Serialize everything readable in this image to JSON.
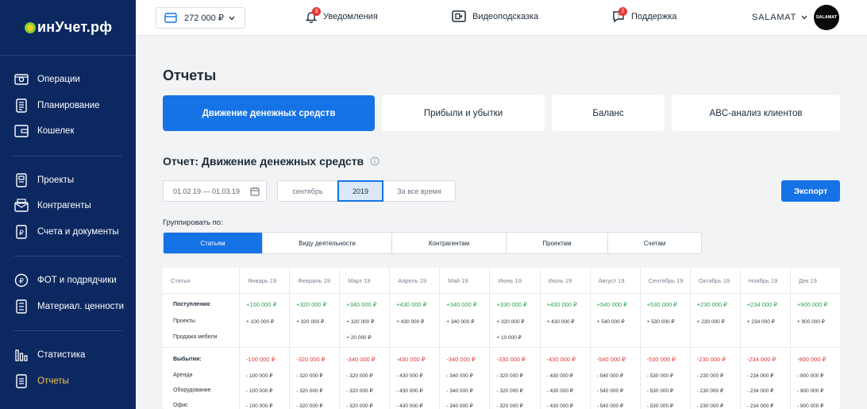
{
  "logo": {
    "text": "инУчет.рф"
  },
  "sidebar": {
    "groups": [
      [
        {
          "label": "Операции",
          "icon": "wallet-card-icon"
        },
        {
          "label": "Планирование",
          "icon": "planning-icon"
        },
        {
          "label": "Кошелек",
          "icon": "wallet-icon"
        }
      ],
      [
        {
          "label": "Проекты",
          "icon": "projects-icon"
        },
        {
          "label": "Контрагенты",
          "icon": "contacts-icon"
        },
        {
          "label": "Счета и документы",
          "icon": "documents-icon"
        }
      ],
      [
        {
          "label": "ФОТ и подрядчики",
          "icon": "payroll-icon"
        },
        {
          "label": "Материал. ценности",
          "icon": "inventory-icon"
        }
      ],
      [
        {
          "label": "Статистика",
          "icon": "statistics-icon"
        },
        {
          "label": "Отчеты",
          "icon": "reports-icon",
          "active": true
        }
      ]
    ]
  },
  "header": {
    "balance": "272 000 ₽",
    "notifications": {
      "label": "Уведомления",
      "count": "3"
    },
    "video_hint": {
      "label": "Видеоподсказка"
    },
    "support": {
      "label": "Поддержка",
      "count": "2"
    },
    "user": "SALAMAT",
    "avatar_text": "SALAMAT"
  },
  "page": {
    "title": "Отчеты",
    "report_tabs": [
      "Движение денежных средств",
      "Прибыли и убытки",
      "Баланс",
      "ABC-анализ клиентов"
    ],
    "section_title": "Отчет: Движение денежных средств",
    "date_range": "01.02 19 — 01.03.19",
    "periods": [
      "сентябрь",
      "2019",
      "За все время"
    ],
    "export_label": "Экспорт",
    "group_by_label": "Группировать по:",
    "group_tabs": [
      "Статьям",
      "Виду деятельности",
      "Контрагентам",
      "Проектам",
      "Счетам"
    ]
  },
  "table": {
    "first_header": "Статья",
    "months": [
      "Январь 19",
      "Февраль 19",
      "Март 19",
      "Апрель 19",
      "Май 19",
      "Июнь 19",
      "Июль 19",
      "Август 19",
      "Сентябрь 19",
      "Октябрь 19",
      "Ноябрь 19",
      "Дек 19"
    ],
    "income_label": "Поступления:",
    "income_rows": [
      "Проекты",
      "Продажа мебели"
    ],
    "income_totals": [
      "+100 000 ₽",
      "+320 000 ₽",
      "+340 000 ₽",
      "+430 000 ₽",
      "+340 000 ₽",
      "+330 000 ₽",
      "+430 000 ₽",
      "+540 000 ₽",
      "+530 000 ₽",
      "+230 000 ₽",
      "+234 000 ₽",
      "+900 000 ₽"
    ],
    "income_projects": [
      "+ 100 000 ₽",
      "+ 320 000 ₽",
      "+ 320 000 ₽",
      "+ 430 000 ₽",
      "+ 340 000 ₽",
      "+ 320 000 ₽",
      "+ 430 000 ₽",
      "+ 540 000 ₽",
      "+ 530 000 ₽",
      "+ 230 000 ₽",
      "+ 234 000 ₽",
      "+ 900 000 ₽"
    ],
    "income_furniture": [
      "",
      "",
      "+ 20 000 ₽",
      "",
      "",
      "+ 10 000 ₽",
      "",
      "",
      "",
      "",
      "",
      ""
    ],
    "expense_label": "Выбытия:",
    "expense_rows": [
      "Аренда",
      "Оборудование",
      "Офис"
    ],
    "expense_totals": [
      "-100 000 ₽",
      "-320 000 ₽",
      "-340 000 ₽",
      "-430 000 ₽",
      "-340 000 ₽",
      "-330 000 ₽",
      "-430 000 ₽",
      "-540 000 ₽",
      "-530 000 ₽",
      "-230 000 ₽",
      "-234 000 ₽",
      "-900 000 ₽"
    ],
    "expense_rent": [
      "- 100 000 ₽",
      "- 320 000 ₽",
      "- 320 000 ₽",
      "- 430 000 ₽",
      "- 340 000 ₽",
      "- 320 000 ₽",
      "- 430 000 ₽",
      "- 540 000 ₽",
      "- 530 000 ₽",
      "- 230 000 ₽",
      "- 234 000 ₽",
      "- 900 000 ₽"
    ],
    "expense_equipment": [
      "- 100 000 ₽",
      "- 320 000 ₽",
      "- 320 000 ₽",
      "- 430 000 ₽",
      "- 340 000 ₽",
      "- 320 000 ₽",
      "- 430 000 ₽",
      "- 540 000 ₽",
      "- 530 000 ₽",
      "- 230 000 ₽",
      "- 234 000 ₽",
      "- 900 000 ₽"
    ],
    "expense_office": [
      "- 100 000 ₽",
      "- 320 000 ₽",
      "- 320 000 ₽",
      "- 430 000 ₽",
      "- 340 000 ₽",
      "- 320 000 ₽",
      "- 430 000 ₽",
      "- 540 000 ₽",
      "- 530 000 ₽",
      "- 230 000 ₽",
      "- 234 000 ₽",
      "- 900 000 ₽"
    ]
  },
  "colors": {
    "sidebar": "#0c2860",
    "accent": "#1673e6",
    "positive": "#2ea44f",
    "negative": "#e03c3c",
    "active_nav": "#f5c542"
  }
}
